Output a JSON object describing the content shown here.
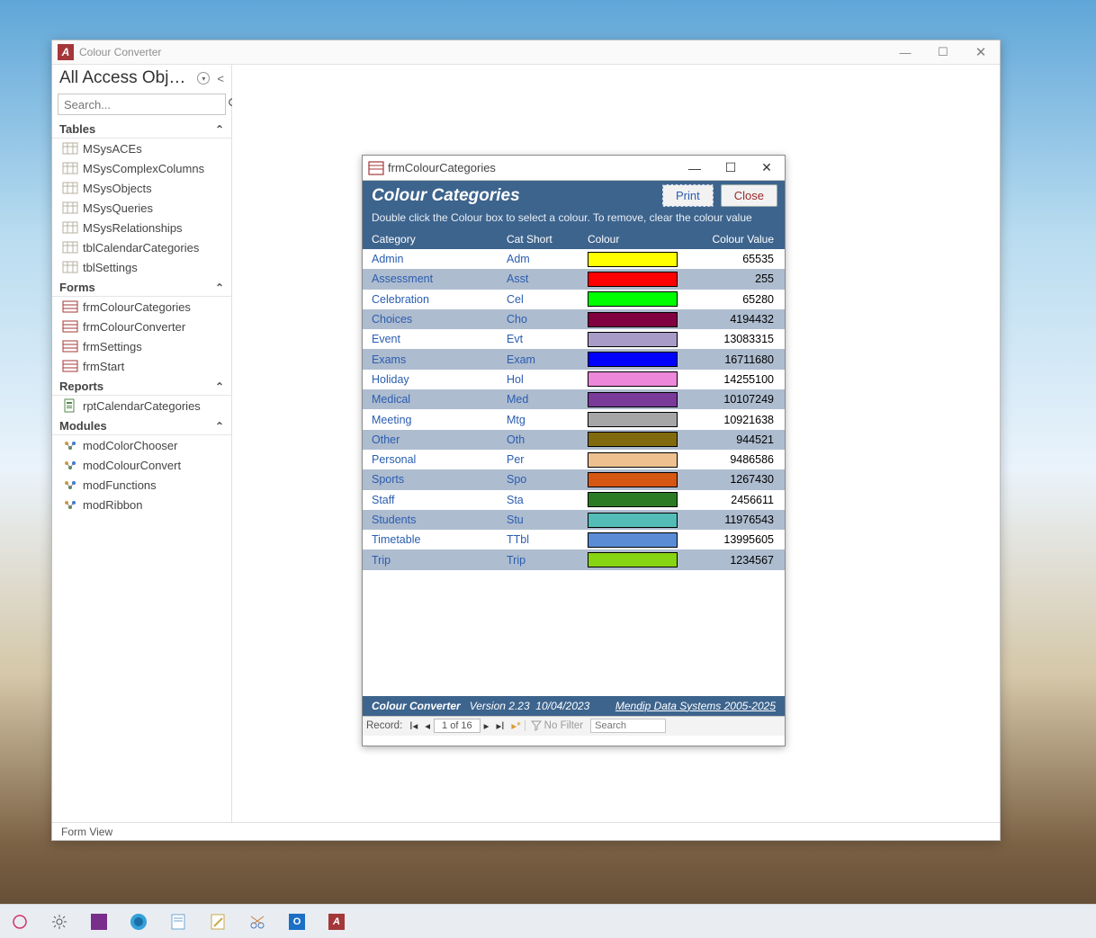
{
  "app": {
    "title": "Colour Converter",
    "status": "Form View"
  },
  "nav": {
    "title": "All Access Obj…",
    "search_placeholder": "Search...",
    "groups": [
      {
        "label": "Tables",
        "type": "table",
        "items": [
          "MSysACEs",
          "MSysComplexColumns",
          "MSysObjects",
          "MSysQueries",
          "MSysRelationships",
          "tblCalendarCategories",
          "tblSettings"
        ]
      },
      {
        "label": "Forms",
        "type": "form",
        "items": [
          "frmColourCategories",
          "frmColourConverter",
          "frmSettings",
          "frmStart"
        ]
      },
      {
        "label": "Reports",
        "type": "report",
        "items": [
          "rptCalendarCategories"
        ]
      },
      {
        "label": "Modules",
        "type": "module",
        "items": [
          "modColorChooser",
          "modColourConvert",
          "modFunctions",
          "modRibbon"
        ]
      }
    ]
  },
  "form": {
    "window_title": "frmColourCategories",
    "heading": "Colour Categories",
    "print_label": "Print",
    "close_label": "Close",
    "hint": "Double click the Colour box to select a colour.  To remove, clear the colour value",
    "columns": {
      "cat": "Category",
      "short": "Cat Short",
      "colour": "Colour",
      "value": "Colour Value"
    },
    "rows": [
      {
        "cat": "Admin",
        "short": "Adm",
        "colour": "#ffff00",
        "value": "65535"
      },
      {
        "cat": "Assessment",
        "short": "Asst",
        "colour": "#ff0000",
        "value": "255"
      },
      {
        "cat": "Celebration",
        "short": "Cel",
        "colour": "#00ff00",
        "value": "65280"
      },
      {
        "cat": "Choices",
        "short": "Cho",
        "colour": "#800040",
        "value": "4194432"
      },
      {
        "cat": "Event",
        "short": "Evt",
        "colour": "#a89bc7",
        "value": "13083315"
      },
      {
        "cat": "Exams",
        "short": "Exam",
        "colour": "#0000ff",
        "value": "16711680"
      },
      {
        "cat": "Holiday",
        "short": "Hol",
        "colour": "#ec87d9",
        "value": "14255100"
      },
      {
        "cat": "Medical",
        "short": "Med",
        "colour": "#793a9a",
        "value": "10107249"
      },
      {
        "cat": "Meeting",
        "short": "Mtg",
        "colour": "#a6a6a6",
        "value": "10921638"
      },
      {
        "cat": "Other",
        "short": "Oth",
        "colour": "#816a0d",
        "value": "944521"
      },
      {
        "cat": "Personal",
        "short": "Per",
        "colour": "#eec090",
        "value": "9486586"
      },
      {
        "cat": "Sports",
        "short": "Spo",
        "colour": "#d65713",
        "value": "1267430"
      },
      {
        "cat": "Staff",
        "short": "Sta",
        "colour": "#2b7b25",
        "value": "2456611"
      },
      {
        "cat": "Students",
        "short": "Stu",
        "colour": "#53bcb6",
        "value": "11976543"
      },
      {
        "cat": "Timetable",
        "short": "TTbl",
        "colour": "#598cd5",
        "value": "13995605"
      },
      {
        "cat": "Trip",
        "short": "Trip",
        "colour": "#87d412",
        "value": "1234567"
      }
    ],
    "footer": {
      "name": "Colour Converter",
      "version": "Version 2.23",
      "date": "10/04/2023",
      "credit": "Mendip Data Systems 2005-2025"
    },
    "recnav": {
      "label": "Record:",
      "counter": "1 of 16",
      "filter": "No Filter",
      "search_placeholder": "Search"
    }
  }
}
